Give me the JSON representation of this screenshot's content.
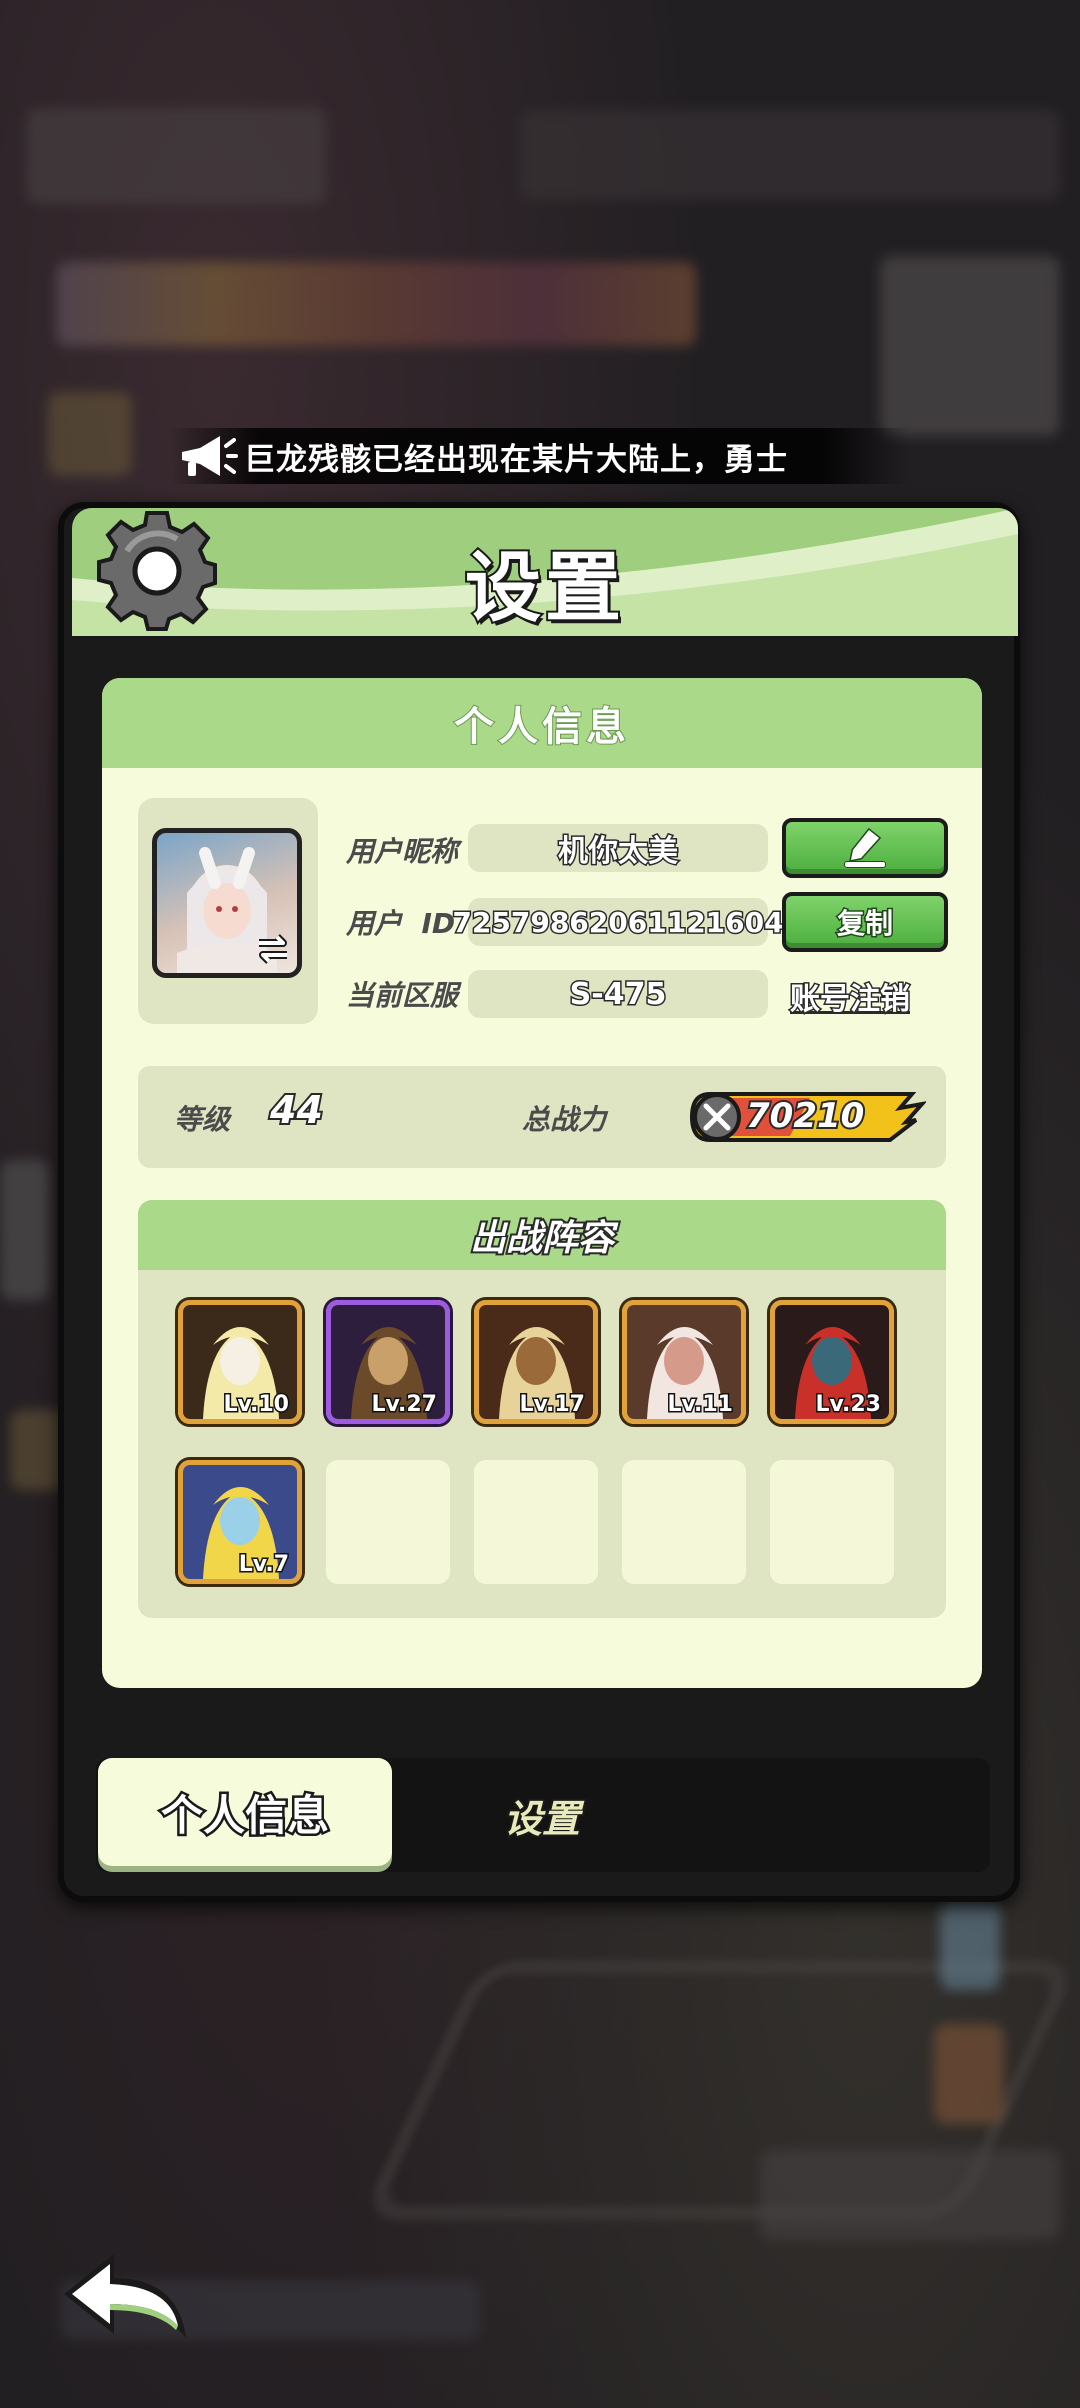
{
  "announcement": {
    "text": "巨龙残骸已经出现在某片大陆上，勇士"
  },
  "dialog": {
    "title": "设置",
    "panel_title": "个人信息",
    "profile": {
      "nickname_label": "用户昵称",
      "nickname": "机你太美",
      "user_id_label": "用户  ID",
      "user_id": "72579862061121604",
      "server_label": "当前区服",
      "server": "S-475",
      "copy_label": "复制",
      "cancel_account_label": "账号注销"
    },
    "stats": {
      "level_label": "等级",
      "level": "44",
      "power_label": "总战力",
      "power": "70210"
    },
    "lineup": {
      "title": "出战阵容",
      "heroes": [
        {
          "level": "Lv.10",
          "frame": "orange",
          "palette": [
            "#3b2a1a",
            "#f3e9a8",
            "#f5f0e3"
          ]
        },
        {
          "level": "Lv.27",
          "frame": "purple",
          "palette": [
            "#2d1e3e",
            "#6b4a2a",
            "#c9a06a"
          ]
        },
        {
          "level": "Lv.17",
          "frame": "orange",
          "palette": [
            "#4a2a18",
            "#e7d29a",
            "#9a6a3a"
          ]
        },
        {
          "level": "Lv.11",
          "frame": "orange",
          "palette": [
            "#5a3a2a",
            "#f1e6e0",
            "#d59a8a"
          ]
        },
        {
          "level": "Lv.23",
          "frame": "orange",
          "palette": [
            "#2a1a1a",
            "#c9302a",
            "#3a6a7a"
          ]
        },
        {
          "level": "Lv.7",
          "frame": "orange",
          "palette": [
            "#3a4a8a",
            "#f2d64a",
            "#9ad0e8"
          ]
        }
      ],
      "empty_slots": 4
    },
    "tabs": [
      {
        "label": "个人信息",
        "active": true
      },
      {
        "label": "设置",
        "active": false
      }
    ]
  },
  "colors": {
    "panel": "#f6fbdc",
    "header_green": "#a9d989",
    "button_green": "#5cbf48",
    "field": "#dfe4c2"
  },
  "icons": [
    "megaphone-icon",
    "gear-icon",
    "swap-icon",
    "edit-icon",
    "sword-icon",
    "back-arrow-icon"
  ]
}
